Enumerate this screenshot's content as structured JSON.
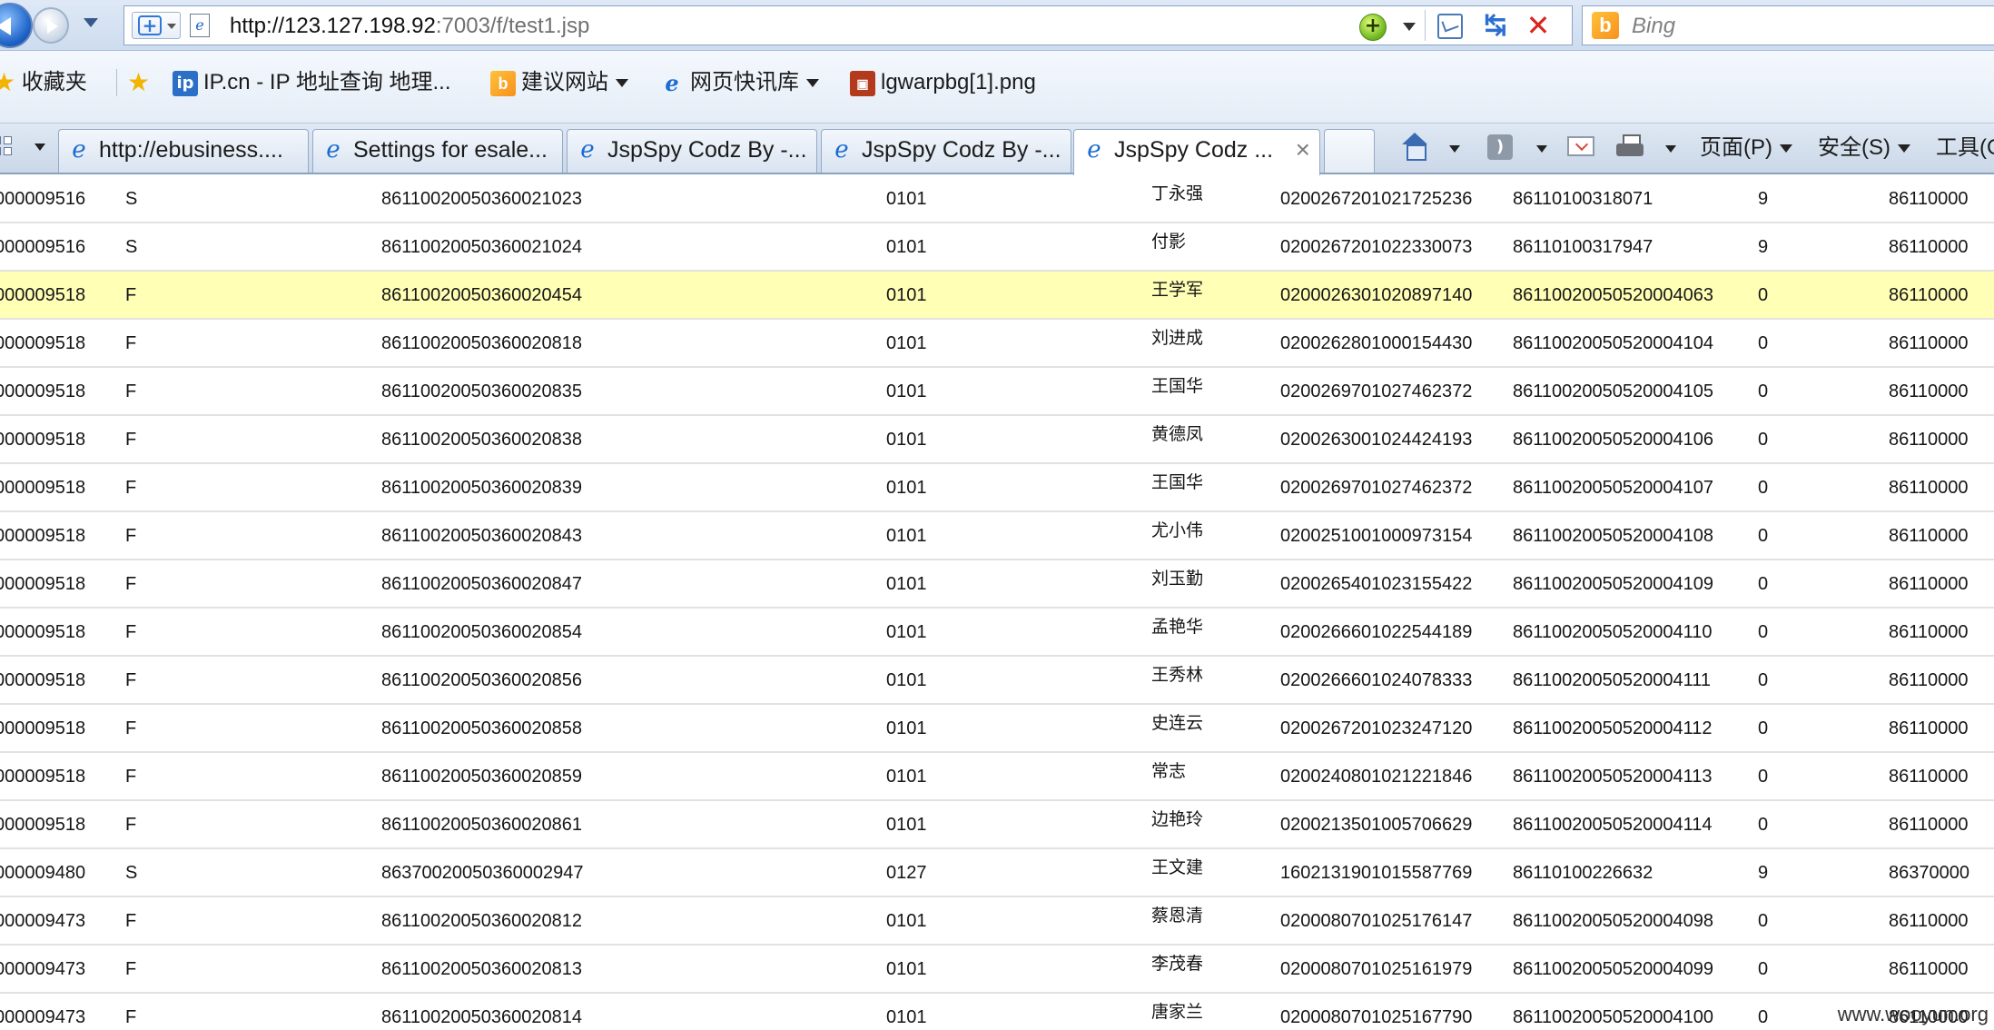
{
  "address_bar": {
    "url_host": "http://123.127.198.92",
    "url_rest": ":7003/f/test1.jsp",
    "search_placeholder": "Bing",
    "bing_logo_letter": "b",
    "compat_icon_glyph": "+",
    "refresh_glyph": "↹",
    "stop_glyph": "✕"
  },
  "favorites_bar": {
    "favorites_label": "收藏夹",
    "items": [
      {
        "label": "IP.cn - IP 地址查询  地理...",
        "icon": "ip-icon"
      },
      {
        "label": "建议网站",
        "icon": "bing-icon"
      },
      {
        "label": "网页快讯库",
        "icon": "ie-icon"
      },
      {
        "label": "lgwarpbg[1].png",
        "icon": "png-icon"
      }
    ]
  },
  "tabs": [
    {
      "label": "http://ebusiness....",
      "active": false
    },
    {
      "label": "Settings for esale...",
      "active": false
    },
    {
      "label": "JspSpy Codz By -...",
      "active": false
    },
    {
      "label": "JspSpy Codz By -...",
      "active": false
    },
    {
      "label": "JspSpy Codz ...",
      "active": true
    }
  ],
  "command_bar": {
    "page_label": "页面(P)",
    "safety_label": "安全(S)",
    "tools_label": "工具(O)"
  },
  "table": {
    "rows": [
      {
        "c1": "000009516",
        "c2": "S",
        "c3": "86110020050360021023",
        "c4": "0101",
        "c5": "丁永强",
        "c6": "0200267201021725236",
        "c7": "86110100318071",
        "c8": "9",
        "c9": "86110000",
        "highlight": false
      },
      {
        "c1": "000009516",
        "c2": "S",
        "c3": "86110020050360021024",
        "c4": "0101",
        "c5": "付影",
        "c6": "0200267201022330073",
        "c7": "86110100317947",
        "c8": "9",
        "c9": "86110000",
        "highlight": false
      },
      {
        "c1": "000009518",
        "c2": "F",
        "c3": "86110020050360020454",
        "c4": "0101",
        "c5": "王学军",
        "c6": "0200026301020897140",
        "c7": "86110020050520004063",
        "c8": "0",
        "c9": "86110000",
        "highlight": true
      },
      {
        "c1": "000009518",
        "c2": "F",
        "c3": "86110020050360020818",
        "c4": "0101",
        "c5": "刘进成",
        "c6": "0200262801000154430",
        "c7": "86110020050520004104",
        "c8": "0",
        "c9": "86110000",
        "highlight": false
      },
      {
        "c1": "000009518",
        "c2": "F",
        "c3": "86110020050360020835",
        "c4": "0101",
        "c5": "王国华",
        "c6": "0200269701027462372",
        "c7": "86110020050520004105",
        "c8": "0",
        "c9": "86110000",
        "highlight": false
      },
      {
        "c1": "000009518",
        "c2": "F",
        "c3": "86110020050360020838",
        "c4": "0101",
        "c5": "黄德凤",
        "c6": "0200263001024424193",
        "c7": "86110020050520004106",
        "c8": "0",
        "c9": "86110000",
        "highlight": false
      },
      {
        "c1": "000009518",
        "c2": "F",
        "c3": "86110020050360020839",
        "c4": "0101",
        "c5": "王国华",
        "c6": "0200269701027462372",
        "c7": "86110020050520004107",
        "c8": "0",
        "c9": "86110000",
        "highlight": false
      },
      {
        "c1": "000009518",
        "c2": "F",
        "c3": "86110020050360020843",
        "c4": "0101",
        "c5": "尤小伟",
        "c6": "0200251001000973154",
        "c7": "86110020050520004108",
        "c8": "0",
        "c9": "86110000",
        "highlight": false
      },
      {
        "c1": "000009518",
        "c2": "F",
        "c3": "86110020050360020847",
        "c4": "0101",
        "c5": "刘玉勤",
        "c6": "0200265401023155422",
        "c7": "86110020050520004109",
        "c8": "0",
        "c9": "86110000",
        "highlight": false
      },
      {
        "c1": "000009518",
        "c2": "F",
        "c3": "86110020050360020854",
        "c4": "0101",
        "c5": "孟艳华",
        "c6": "0200266601022544189",
        "c7": "86110020050520004110",
        "c8": "0",
        "c9": "86110000",
        "highlight": false
      },
      {
        "c1": "000009518",
        "c2": "F",
        "c3": "86110020050360020856",
        "c4": "0101",
        "c5": "王秀林",
        "c6": "0200266601024078333",
        "c7": "86110020050520004111",
        "c8": "0",
        "c9": "86110000",
        "highlight": false
      },
      {
        "c1": "000009518",
        "c2": "F",
        "c3": "86110020050360020858",
        "c4": "0101",
        "c5": "史连云",
        "c6": "0200267201023247120",
        "c7": "86110020050520004112",
        "c8": "0",
        "c9": "86110000",
        "highlight": false
      },
      {
        "c1": "000009518",
        "c2": "F",
        "c3": "86110020050360020859",
        "c4": "0101",
        "c5": "常志",
        "c6": "0200240801021221846",
        "c7": "86110020050520004113",
        "c8": "0",
        "c9": "86110000",
        "highlight": false
      },
      {
        "c1": "000009518",
        "c2": "F",
        "c3": "86110020050360020861",
        "c4": "0101",
        "c5": "边艳玲",
        "c6": "0200213501005706629",
        "c7": "86110020050520004114",
        "c8": "0",
        "c9": "86110000",
        "highlight": false
      },
      {
        "c1": "000009480",
        "c2": "S",
        "c3": "86370020050360002947",
        "c4": "0127",
        "c5": "王文建",
        "c6": "1602131901015587769",
        "c7": "86110100226632",
        "c8": "9",
        "c9": "86370000",
        "highlight": false
      },
      {
        "c1": "000009473",
        "c2": "F",
        "c3": "86110020050360020812",
        "c4": "0101",
        "c5": "蔡恩清",
        "c6": "0200080701025176147",
        "c7": "86110020050520004098",
        "c8": "0",
        "c9": "86110000",
        "highlight": false
      },
      {
        "c1": "000009473",
        "c2": "F",
        "c3": "86110020050360020813",
        "c4": "0101",
        "c5": "李茂春",
        "c6": "0200080701025161979",
        "c7": "86110020050520004099",
        "c8": "0",
        "c9": "86110000",
        "highlight": false
      },
      {
        "c1": "000009473",
        "c2": "F",
        "c3": "86110020050360020814",
        "c4": "0101",
        "c5": "唐家兰",
        "c6": "0200080701025167790",
        "c7": "86110020050520004100",
        "c8": "0",
        "c9": "86110000",
        "highlight": false
      }
    ]
  },
  "watermark": "www.wooyun.org",
  "colors": {
    "highlight_row": "#ffffb5",
    "row_border": "#e2e2e2",
    "chrome_blue": "#cddcef"
  }
}
